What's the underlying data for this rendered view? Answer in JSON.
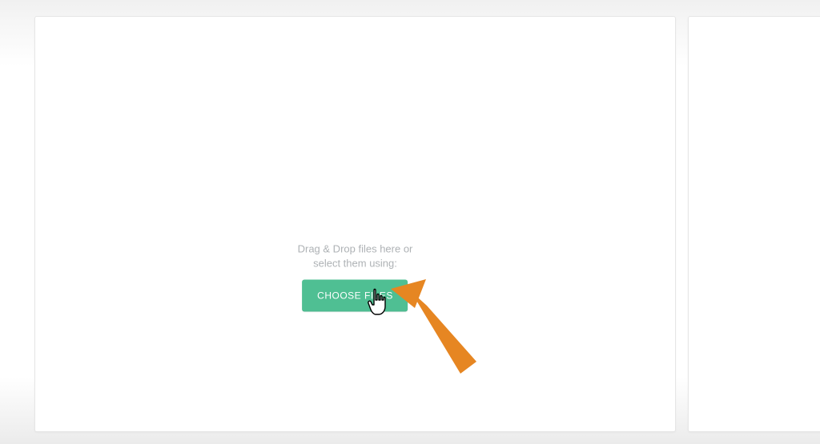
{
  "upload": {
    "drag_line1": "Drag & Drop files here or",
    "drag_line2": "select them using:",
    "choose_label": "CHOOSE FILES"
  },
  "colors": {
    "button": "#4fbf93",
    "hint_text": "#aeb2b5",
    "arrow": "#e68622"
  }
}
